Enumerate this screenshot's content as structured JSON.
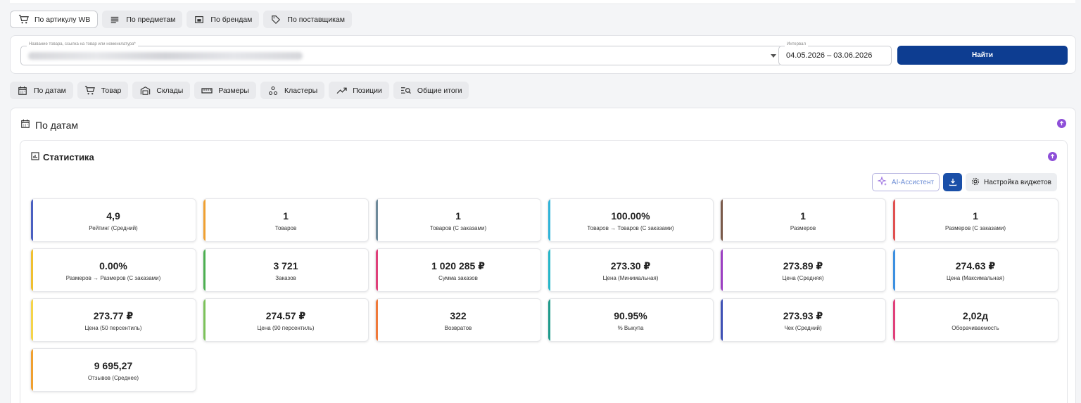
{
  "search_tabs": [
    {
      "label": "По артикулу WB",
      "icon": "cart-icon",
      "active": true
    },
    {
      "label": "По предметам",
      "icon": "list-icon",
      "active": false
    },
    {
      "label": "По брендам",
      "icon": "brand-icon",
      "active": false
    },
    {
      "label": "По поставщикам",
      "icon": "tag-icon",
      "active": false
    }
  ],
  "search": {
    "name_label": "Название товара, ссылка на товар или номенклатура*",
    "interval_label": "Интервал",
    "interval_value": "04.05.2026 – 03.06.2026",
    "find_label": "Найти"
  },
  "view_tabs": [
    {
      "label": "По датам",
      "icon": "calendar-icon"
    },
    {
      "label": "Товар",
      "icon": "cart-icon"
    },
    {
      "label": "Склады",
      "icon": "warehouse-icon"
    },
    {
      "label": "Размеры",
      "icon": "ruler-icon"
    },
    {
      "label": "Кластеры",
      "icon": "clusters-icon"
    },
    {
      "label": "Позиции",
      "icon": "trend-icon"
    },
    {
      "label": "Общие итоги",
      "icon": "summary-icon"
    }
  ],
  "section": {
    "title": "По датам"
  },
  "stats": {
    "title": "Статистика",
    "ai_label": "AI-Ассистент",
    "config_label": "Настройка виджетов",
    "metrics": [
      {
        "value": "4,9",
        "label": "Рейтинг (Средний)",
        "color": "#4a5fc1"
      },
      {
        "value": "1",
        "label": "Товаров",
        "color": "#f0a030"
      },
      {
        "value": "1",
        "label": "Товаров (С заказами)",
        "color": "#6e8a9a"
      },
      {
        "value": "100.00%",
        "label": "Товаров → Товаров (С заказами)",
        "color": "#2fb3d8"
      },
      {
        "value": "1",
        "label": "Размеров",
        "color": "#7a5a4a"
      },
      {
        "value": "1",
        "label": "Размеров (С заказами)",
        "color": "#e05050"
      },
      {
        "value": "0.00%",
        "label": "Размеров → Размеров (С заказами)",
        "color": "#f0c030"
      },
      {
        "value": "3 721",
        "label": "Заказов",
        "color": "#4caf50"
      },
      {
        "value": "1 020 285 ₽",
        "label": "Сумма заказов",
        "color": "#e0407a"
      },
      {
        "value": "273.30 ₽",
        "label": "Цена (Минимальная)",
        "color": "#26b6c8"
      },
      {
        "value": "273.89 ₽",
        "label": "Цена (Средняя)",
        "color": "#9c3fc2"
      },
      {
        "value": "274.63 ₽",
        "label": "Цена (Максимальная)",
        "color": "#3b8fe0"
      },
      {
        "value": "273.77 ₽",
        "label": "Цена (50 персентиль)",
        "color": "#f5d44a"
      },
      {
        "value": "274.57 ₽",
        "label": "Цена (90 персентиль)",
        "color": "#7cc25a"
      },
      {
        "value": "322",
        "label": "Возвратов",
        "color": "#f07a3a"
      },
      {
        "value": "90.95%",
        "label": "% Выкупа",
        "color": "#1e9a8a"
      },
      {
        "value": "273.93 ₽",
        "label": "Чек (Средний)",
        "color": "#3f51b5"
      },
      {
        "value": "2,02д",
        "label": "Оборачиваемость",
        "color": "#e0407a"
      },
      {
        "value": "9 695,27",
        "label": "Отзывов (Среднее)",
        "color": "#f0a030"
      }
    ]
  }
}
